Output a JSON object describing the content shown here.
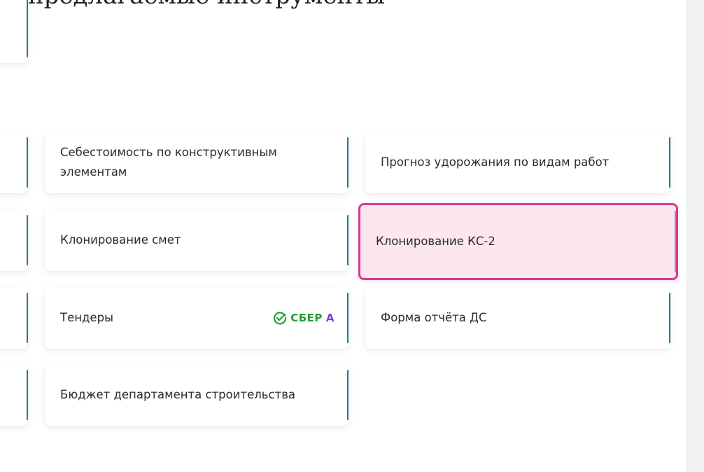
{
  "header_fragment": "предлагаемые инструменты",
  "cards": [
    {
      "label": "Себестоимость по конструктивным элементам"
    },
    {
      "label": "Прогноз удорожания по видам работ"
    },
    {
      "label": "Клонирование смет"
    },
    {
      "label": "Клонирование КС-2",
      "selected": true
    },
    {
      "label": "Тендеры",
      "badge": {
        "word": "СБЕР",
        "letter": "А",
        "icon": "check-circle-icon"
      }
    },
    {
      "label": "Форма отчёта ДС"
    },
    {
      "label": "Бюджет департамента строительства"
    }
  ],
  "colors": {
    "accent": "#1f7f8c",
    "selected_border": "#d23d8f",
    "selected_background": "#fce6ef",
    "sber_green": "#21a038",
    "sber_purple": "#7a3cd6"
  }
}
